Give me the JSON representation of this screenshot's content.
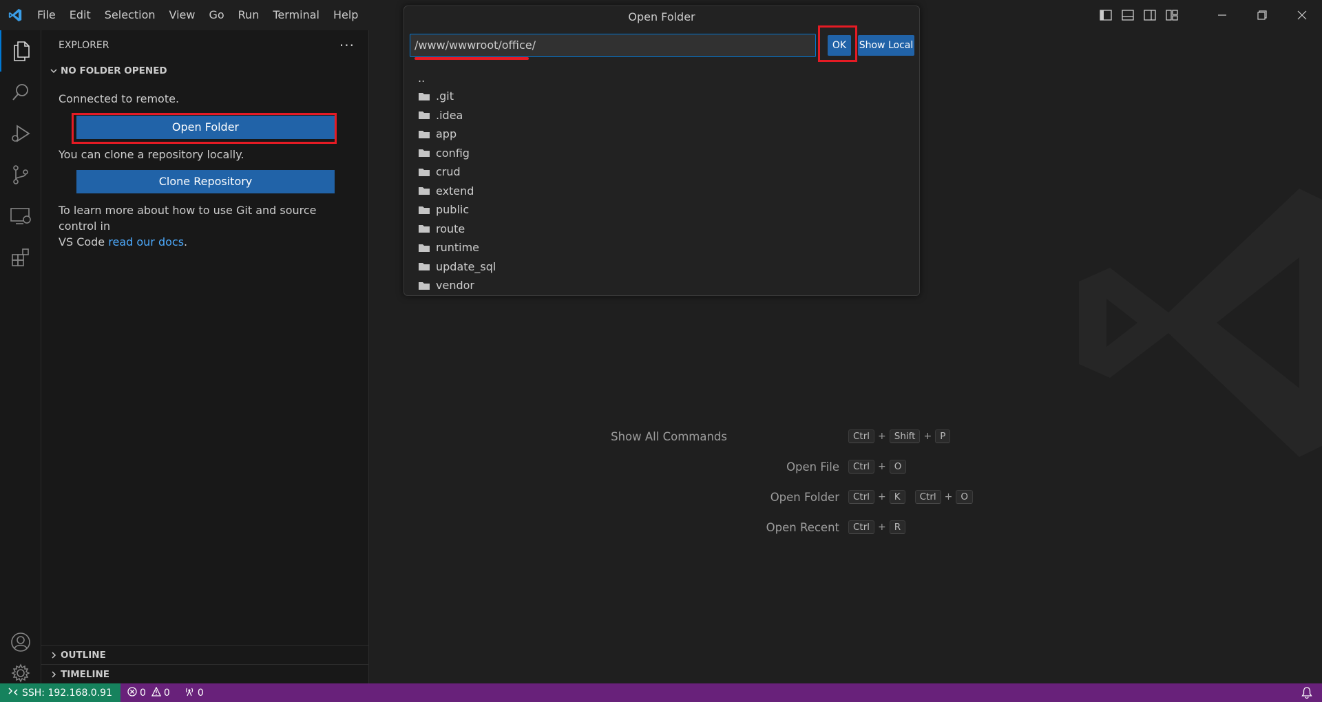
{
  "titlebar": {
    "menu": [
      "File",
      "Edit",
      "Selection",
      "View",
      "Go",
      "Run",
      "Terminal",
      "Help"
    ]
  },
  "activitybar": {
    "items": [
      "explorer-icon",
      "search-icon",
      "run-debug-icon",
      "source-control-icon",
      "remote-explorer-icon",
      "extensions-icon"
    ],
    "bottom": [
      "account-icon",
      "gear-icon"
    ]
  },
  "sidebar": {
    "header": "EXPLORER",
    "section_title": "NO FOLDER OPENED",
    "connected_text": "Connected to remote.",
    "open_folder_label": "Open Folder",
    "clone_text": "You can clone a repository locally.",
    "clone_label": "Clone Repository",
    "learn_text_1": "To learn more about how to use Git and source control in",
    "learn_text_2": "VS Code",
    "learn_link": "read our docs",
    "learn_end": ".",
    "outline": "OUTLINE",
    "timeline": "TIMELINE"
  },
  "dialog": {
    "title": "Open Folder",
    "input_value": "/www/wwwroot/office/",
    "ok_label": "OK",
    "show_local_label": "Show Local",
    "parent": "..",
    "folders": [
      ".git",
      ".idea",
      "app",
      "config",
      "crud",
      "extend",
      "public",
      "route",
      "runtime",
      "update_sql",
      "vendor"
    ]
  },
  "shortcuts": [
    {
      "label": "Show All Commands",
      "keys": [
        [
          "Ctrl",
          "Shift",
          "P"
        ]
      ]
    },
    {
      "label": "Open File",
      "keys": [
        [
          "Ctrl",
          "O"
        ]
      ]
    },
    {
      "label": "Open Folder",
      "keys": [
        [
          "Ctrl",
          "K"
        ],
        [
          "Ctrl",
          "O"
        ]
      ]
    },
    {
      "label": "Open Recent",
      "keys": [
        [
          "Ctrl",
          "R"
        ]
      ]
    }
  ],
  "statusbar": {
    "remote": "SSH: 192.168.0.91",
    "errors": "0",
    "warnings": "0",
    "ports": "0"
  },
  "colors": {
    "accent": "#0078d4",
    "button": "#2163a8",
    "statusbar": "#68217a",
    "remote": "#16825d",
    "highlight": "#e51b24"
  }
}
